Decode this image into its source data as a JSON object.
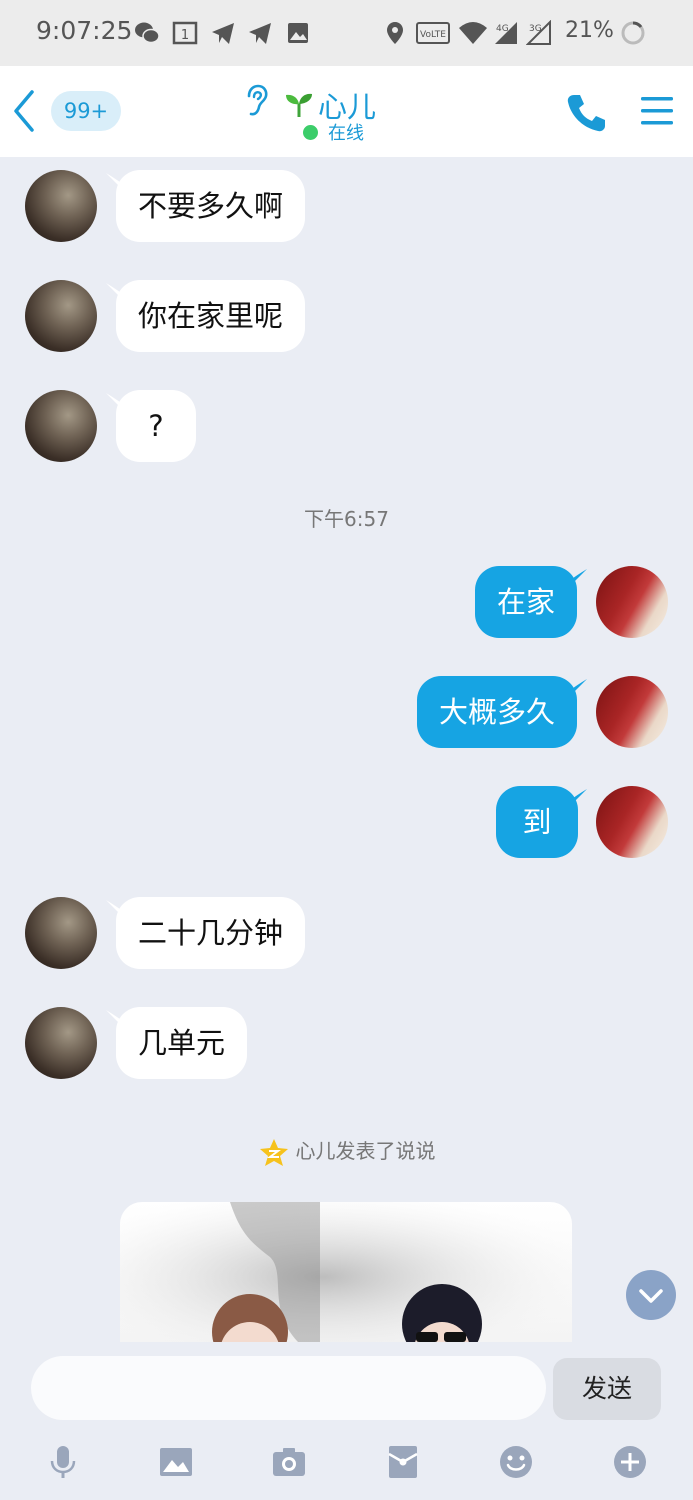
{
  "status_bar": {
    "time": "9:07:25",
    "battery": "21%",
    "net_4g": "4G",
    "net_3g": "3G",
    "volte": "VoLTE",
    "calendar_day": "1"
  },
  "header": {
    "unread_badge": "99+",
    "contact_name": "心儿",
    "status": "在线"
  },
  "messages": [
    {
      "side": "in",
      "text": "不要多久啊"
    },
    {
      "side": "in",
      "text": "你在家里呢"
    },
    {
      "side": "in",
      "text": "?"
    },
    {
      "side": "out",
      "text": "在家"
    },
    {
      "side": "out",
      "text": "大概多久"
    },
    {
      "side": "out",
      "text": "到"
    },
    {
      "side": "in",
      "text": "二十几分钟"
    },
    {
      "side": "in",
      "text": "几单元"
    }
  ],
  "timestamp": "下午6:57",
  "notice": "心儿发表了说说",
  "composer": {
    "placeholder": "",
    "send_label": "发送"
  },
  "colors": {
    "accent": "#16a4e3",
    "online": "#3ccd6a",
    "background": "#eaedf4"
  },
  "toolbar_icons": [
    "mic-icon",
    "image-icon",
    "camera-icon",
    "red-packet-icon",
    "emoji-icon",
    "plus-icon"
  ]
}
